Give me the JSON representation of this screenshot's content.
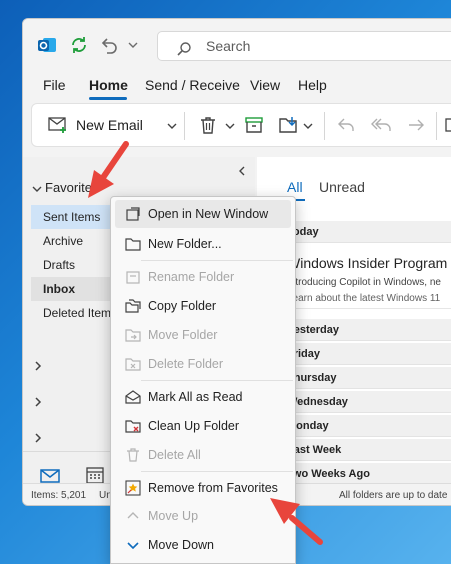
{
  "search": {
    "placeholder": "Search"
  },
  "menu": {
    "file": "File",
    "home": "Home",
    "send_receive": "Send / Receive",
    "view": "View",
    "help": "Help"
  },
  "ribbon": {
    "new_email": "New Email"
  },
  "sidebar": {
    "favorites": "Favorites",
    "items": [
      {
        "label": "Sent Items"
      },
      {
        "label": "Archive"
      },
      {
        "label": "Drafts"
      },
      {
        "label": "Inbox"
      },
      {
        "label": "Deleted Items"
      }
    ]
  },
  "mailpane": {
    "tabs": {
      "all": "All",
      "unread": "Unread"
    },
    "today": "Today",
    "message": {
      "sender": "Windows Insider Program",
      "line1": "Introducing Copilot in Windows, ne",
      "line2": "Learn about the latest Windows 11"
    },
    "groups": [
      "Yesterday",
      "Friday",
      "Thursday",
      "Wednesday",
      "Monday",
      "Last Week",
      "Two Weeks Ago"
    ]
  },
  "status": {
    "items": "Items: 5,201",
    "unread_prefix": "Un",
    "sync": "All folders are up to date"
  },
  "context_menu": {
    "items": [
      {
        "label": "Open in New Window",
        "icon": "open-window-icon",
        "enabled": true
      },
      {
        "label": "New Folder...",
        "icon": "new-folder-icon",
        "enabled": true
      },
      {
        "label": "Rename Folder",
        "icon": "rename-folder-icon",
        "enabled": false
      },
      {
        "label": "Copy Folder",
        "icon": "copy-folder-icon",
        "enabled": true
      },
      {
        "label": "Move Folder",
        "icon": "move-folder-icon",
        "enabled": false
      },
      {
        "label": "Delete Folder",
        "icon": "delete-folder-icon",
        "enabled": false
      },
      {
        "label": "Mark All as Read",
        "icon": "mark-read-icon",
        "enabled": true
      },
      {
        "label": "Clean Up Folder",
        "icon": "clean-up-icon",
        "enabled": true
      },
      {
        "label": "Delete All",
        "icon": "delete-all-icon",
        "enabled": false
      },
      {
        "label": "Remove from Favorites",
        "icon": "star-icon",
        "enabled": true
      },
      {
        "label": "Move Up",
        "icon": "chevron-up-icon",
        "enabled": false
      },
      {
        "label": "Move Down",
        "icon": "chevron-down-icon",
        "enabled": true
      }
    ]
  },
  "colors": {
    "accent": "#0f6cbd",
    "annotation_arrow": "#e8453c"
  }
}
